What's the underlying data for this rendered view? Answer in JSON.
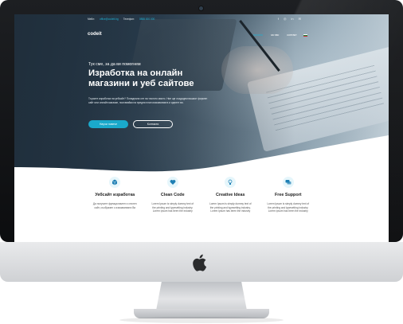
{
  "topbar": {
    "email_label": "Mейл:",
    "email_value": "office@codeit.bg",
    "phone_label": "Телефон:",
    "phone_value": "0888 000 000",
    "social": [
      "f",
      "◎",
      "in",
      "✉"
    ]
  },
  "nav": {
    "logo": "codeit",
    "items": [
      "начало",
      "за нас",
      "контакт"
    ]
  },
  "hero": {
    "tagline": "Тук сме, за да ви помогнем",
    "title_line1": "Изработка на онлайн",
    "title_line2": "магазини и уеб сайтове",
    "lead": "Търсите изработка на уебсайт? Попаднали сте на точното място. Ние ще създадем вашият фирмен сайт или онлайн магазин, поставяйки на предни план изискванията и идеите ви.",
    "primary_button": "Научи повече",
    "secondary_button": "Контакти"
  },
  "features": [
    {
      "icon": "cube-icon",
      "title": "Уебсайт изработка",
      "text": "Да получите функционален и стилен сайт, съобразен с изискванията Ви"
    },
    {
      "icon": "heart-icon",
      "title": "Clean Code",
      "text": "Lorem Ipsum is simply dummy text of the printing and typesetting industry. Lorem Ipsum has been the industry"
    },
    {
      "icon": "lightbulb-icon",
      "title": "Creative Ideas",
      "text": "Lorem Ipsum is simply dummy text of the printing and typesetting industry. Lorem Ipsum has been the industry"
    },
    {
      "icon": "chat-icon",
      "title": "Free Support",
      "text": "Lorem Ipsum is simply dummy text of the printing and typesetting industry. Lorem Ipsum has been the industry"
    }
  ],
  "colors": {
    "accent": "#1aa9cb",
    "hero_dark": "#233240"
  }
}
